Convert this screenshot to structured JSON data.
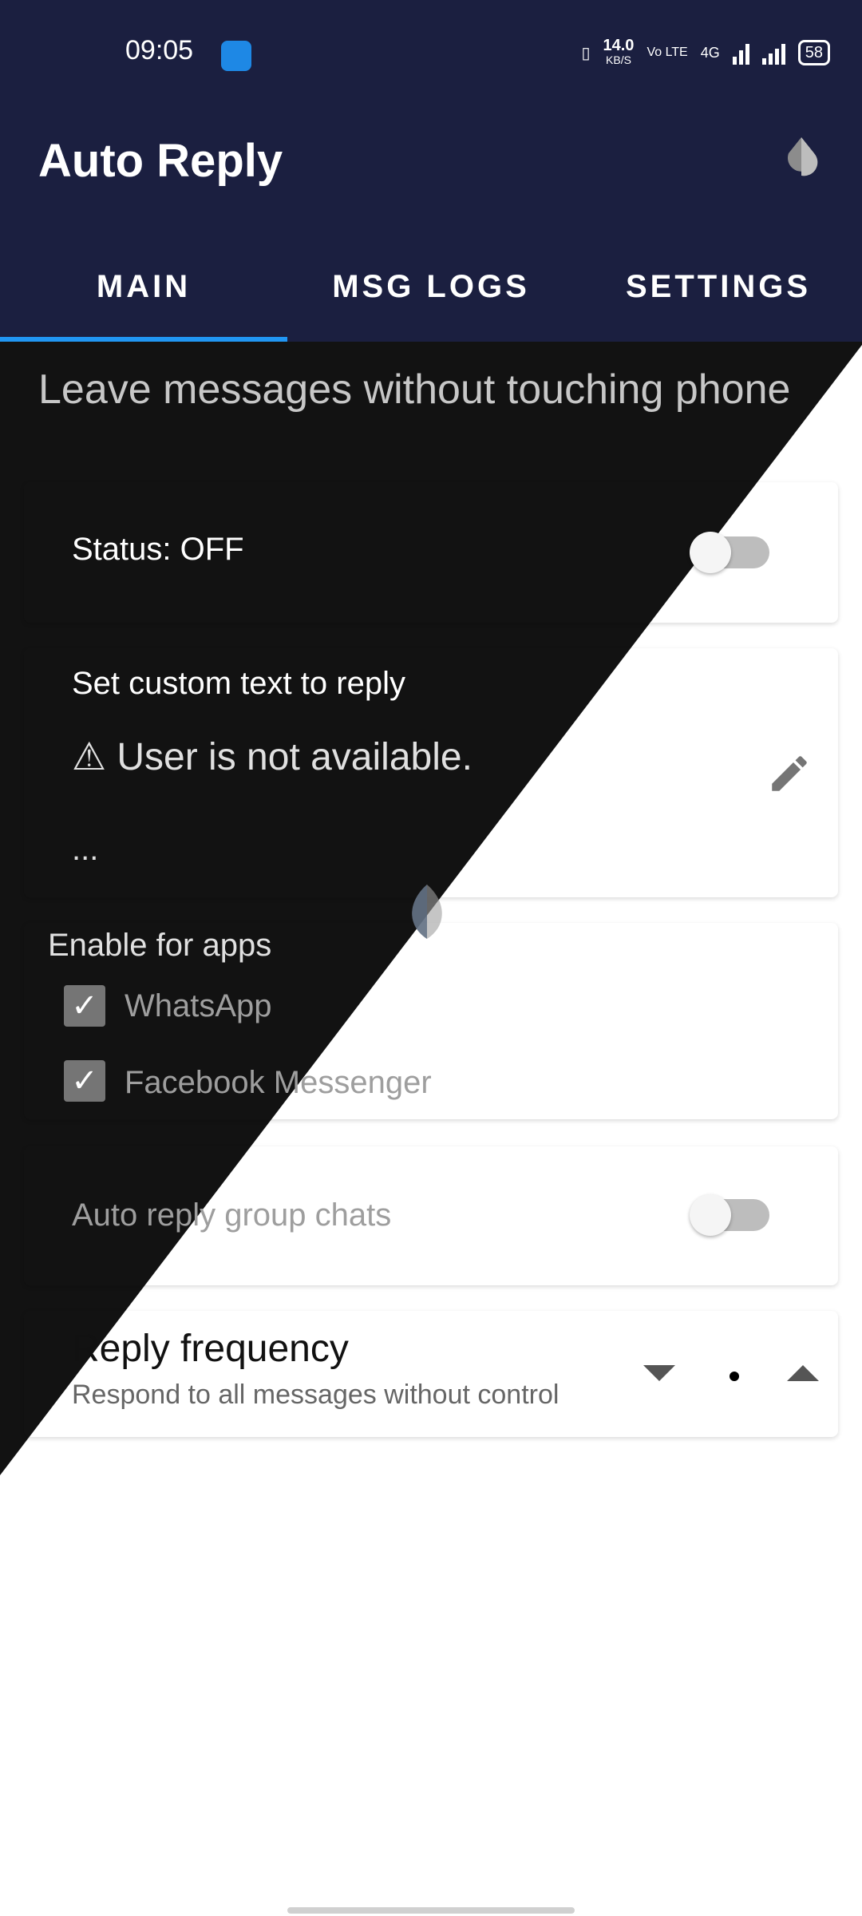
{
  "status_bar": {
    "time": "09:05",
    "speed": "14.0",
    "speed_unit": "KB/S",
    "volte": "Vo LTE",
    "net": "4G",
    "battery": "58"
  },
  "app_bar": {
    "title": "Auto Reply"
  },
  "tabs": [
    {
      "label": "MAIN"
    },
    {
      "label": "MSG LOGS"
    },
    {
      "label": "SETTINGS"
    }
  ],
  "main": {
    "subtitle": "Leave messages without touching phone",
    "status_label": "Status: OFF",
    "custom_text_title": "Set custom text to reply",
    "custom_text_value": "⚠ User is not available.",
    "custom_text_ellipsis": "...",
    "enable_apps_title": "Enable for apps",
    "apps": [
      {
        "label": "WhatsApp",
        "checked": true
      },
      {
        "label": "Facebook Messenger",
        "checked": true
      }
    ],
    "group_chats_label": "Auto reply group chats",
    "reply_frequency_title": "Reply frequency",
    "reply_frequency_subtitle": "Respond to all messages without control"
  },
  "colors": {
    "primary": "#1b1f40",
    "accent": "#2196f3",
    "dark_bg": "#121212",
    "card_dark": "#222222"
  },
  "icons": {
    "theme": "theme-toggle-drop-icon",
    "edit": "pencil-icon",
    "down": "arrow-down-icon",
    "up": "arrow-up-icon"
  }
}
